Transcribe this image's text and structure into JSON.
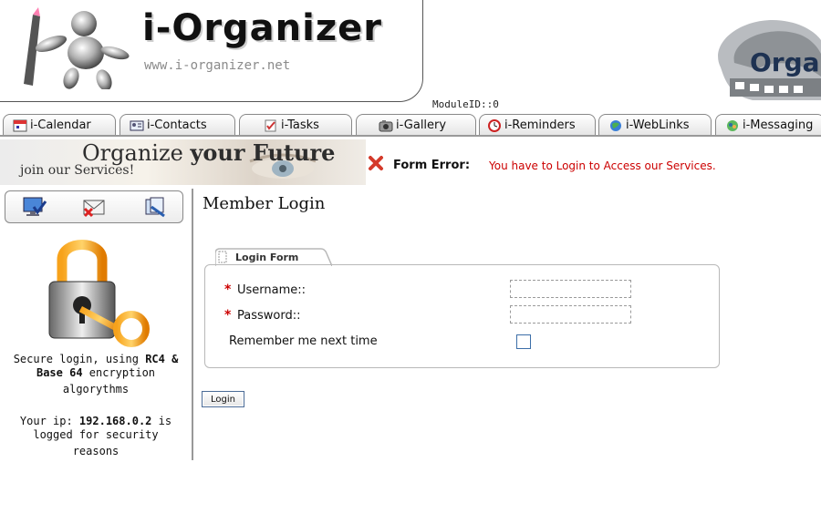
{
  "header": {
    "app_title": "i-Organizer",
    "app_url": "www.i-organizer.net",
    "right_logo_text": "Orga",
    "module_id": "ModuleID::0"
  },
  "tabs": [
    {
      "label": "i-Calendar",
      "icon": "calendar-icon"
    },
    {
      "label": "i-Contacts",
      "icon": "contacts-icon"
    },
    {
      "label": "i-Tasks",
      "icon": "tasks-icon"
    },
    {
      "label": "i-Gallery",
      "icon": "gallery-icon"
    },
    {
      "label": "i-Reminders",
      "icon": "reminders-icon"
    },
    {
      "label": "i-WebLinks",
      "icon": "weblinks-icon"
    },
    {
      "label": "i-Messaging",
      "icon": "messaging-icon"
    }
  ],
  "banner": {
    "title_part1": "Organize ",
    "title_part2": "your Future",
    "subtitle": "join our Services!"
  },
  "error": {
    "label": "Form Error:",
    "message": "You have to Login to Access our Services."
  },
  "sidebar": {
    "toolbar_icons": [
      "desktop-check-icon",
      "mail-delete-icon",
      "documents-icon"
    ],
    "secure_text_pre": "Secure login, using ",
    "secure_rc4": "RC4 &",
    "secure_base64": "Base 64",
    "secure_text_post": " encryption",
    "secure_text_line3": "algorythms",
    "ip_pre": "Your ip: ",
    "ip_value": "192.168.0.2",
    "ip_post": " is",
    "ip_line2": "logged for security",
    "ip_line3": "reasons"
  },
  "main": {
    "title": "Member Login",
    "form_tab_label": "Login Form",
    "username_label": "Username::",
    "password_label": "Password::",
    "remember_label": "Remember me next time",
    "username_value": "",
    "password_value": "",
    "remember_checked": false,
    "login_button": "Login"
  },
  "colors": {
    "error": "#cc0000",
    "required": "#cc0000",
    "border": "#b8b8b8",
    "brand_dark": "#1e3252"
  }
}
